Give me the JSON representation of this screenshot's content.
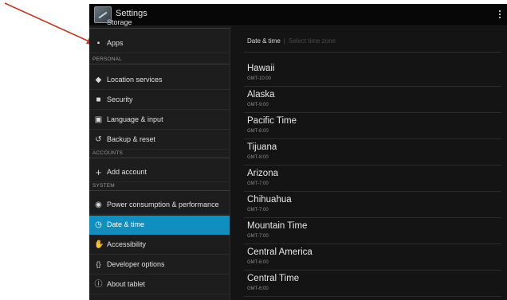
{
  "colors": {
    "accent": "#0f8fc0",
    "arrow": "#c0392b",
    "background": "#121212"
  },
  "action_bar": {
    "title": "Settings",
    "app_icon": "settings-app-icon",
    "menu_icon": "overflow-menu-icon"
  },
  "sidebar": {
    "partial_item": "Storage",
    "items": [
      {
        "label": "Apps",
        "icon": "apps-icon"
      },
      {
        "section": "PERSONAL"
      },
      {
        "label": "Location services",
        "icon": "location-icon"
      },
      {
        "label": "Security",
        "icon": "lock-icon"
      },
      {
        "label": "Language & input",
        "icon": "keyboard-icon"
      },
      {
        "label": "Backup & reset",
        "icon": "backup-icon"
      },
      {
        "section": "ACCOUNTS"
      },
      {
        "label": "Add account",
        "icon": "plus-icon"
      },
      {
        "section": "SYSTEM"
      },
      {
        "label": "Power consumption & performance",
        "icon": "power-icon"
      },
      {
        "label": "Date & time",
        "icon": "clock-icon",
        "selected": true
      },
      {
        "label": "Accessibility",
        "icon": "hand-icon"
      },
      {
        "label": "Developer options",
        "icon": "braces-icon"
      },
      {
        "label": "About tablet",
        "icon": "info-icon"
      }
    ]
  },
  "content": {
    "breadcrumb": {
      "current": "Date & time",
      "hint": "Select time zone"
    },
    "time_zones": [
      {
        "name": "Hawaii",
        "offset": "GMT-10:00"
      },
      {
        "name": "Alaska",
        "offset": "GMT-9:00"
      },
      {
        "name": "Pacific Time",
        "offset": "GMT-8:00"
      },
      {
        "name": "Tijuana",
        "offset": "GMT-8:00"
      },
      {
        "name": "Arizona",
        "offset": "GMT-7:00"
      },
      {
        "name": "Chihuahua",
        "offset": "GMT-7:00"
      },
      {
        "name": "Mountain Time",
        "offset": "GMT-7:00"
      },
      {
        "name": "Central America",
        "offset": "GMT-6:00"
      },
      {
        "name": "Central Time",
        "offset": "GMT-6:00"
      }
    ]
  }
}
